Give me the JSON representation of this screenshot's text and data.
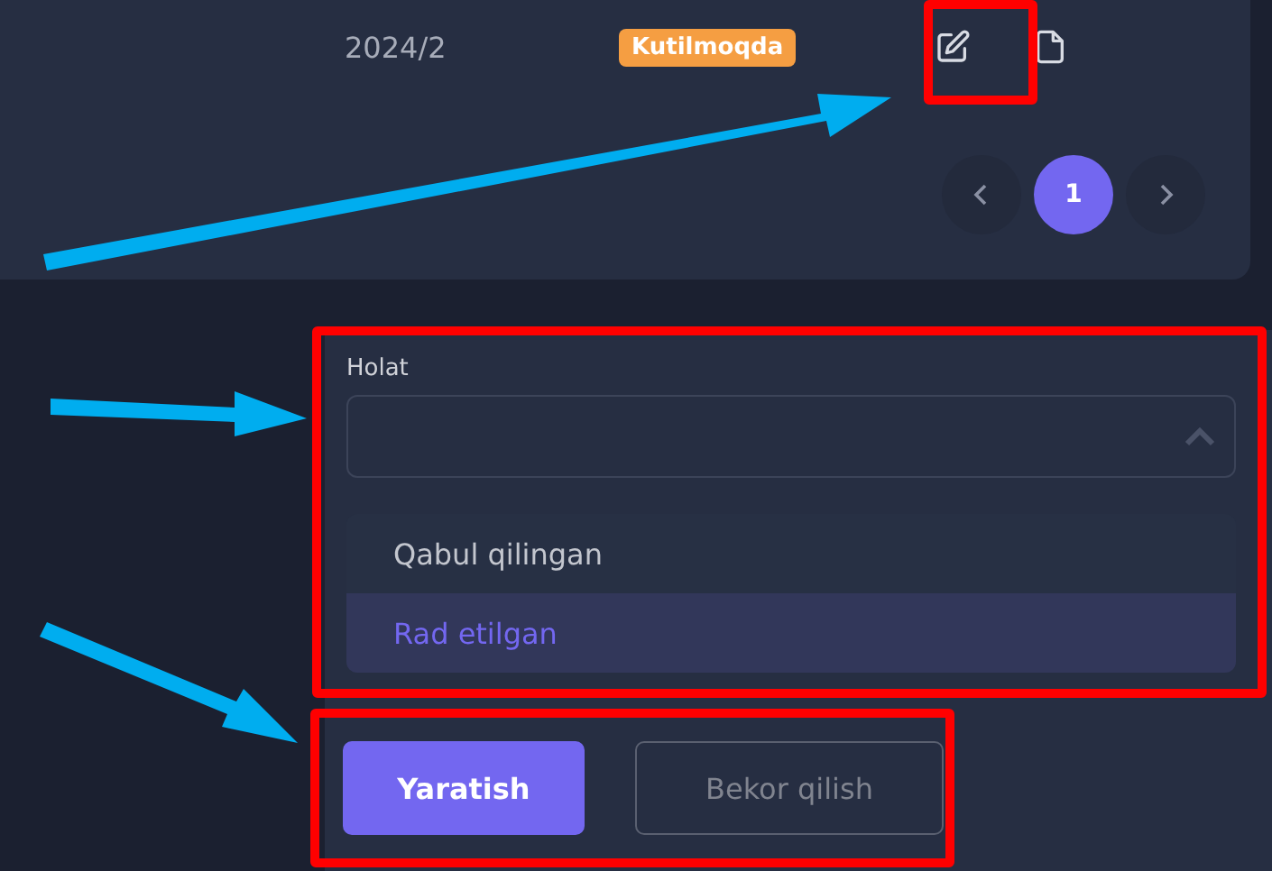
{
  "table_row": {
    "period": "2024/2",
    "status": "Kutilmoqda"
  },
  "pagination": {
    "pages": [
      {
        "label": "1",
        "selected": true
      }
    ]
  },
  "status_select": {
    "label": "Holat",
    "expanded": true,
    "options": [
      {
        "label": "Qabul qilingan",
        "selected": false
      },
      {
        "label": "Rad etilgan",
        "selected": true
      }
    ]
  },
  "buttons": [
    {
      "label": "Yaratish",
      "kind": "primary"
    },
    {
      "label": "Bekor qilish",
      "kind": "secondary"
    }
  ]
}
